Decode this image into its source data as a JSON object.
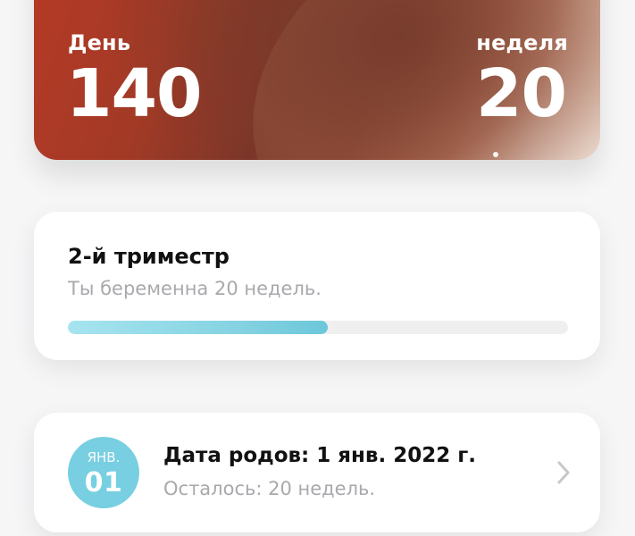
{
  "hero": {
    "day_label": "День",
    "day_value": "140",
    "week_label": "неделя",
    "week_value": "20"
  },
  "trimester": {
    "title": "2-й триместр",
    "subtitle": "Ты беременна 20 недель.",
    "progress_percent": 52
  },
  "due_date": {
    "badge_month": "ЯНВ.",
    "badge_day": "01",
    "title": "Дата родов: 1 янв. 2022 г.",
    "subtitle": "Осталось: 20 недель.",
    "chevron_icon": "chevron-right-icon"
  },
  "colors": {
    "accent": "#78cfe1",
    "progress_start": "#a6e4ef",
    "progress_end": "#6cc7da",
    "muted_text": "#a9a9ad"
  }
}
